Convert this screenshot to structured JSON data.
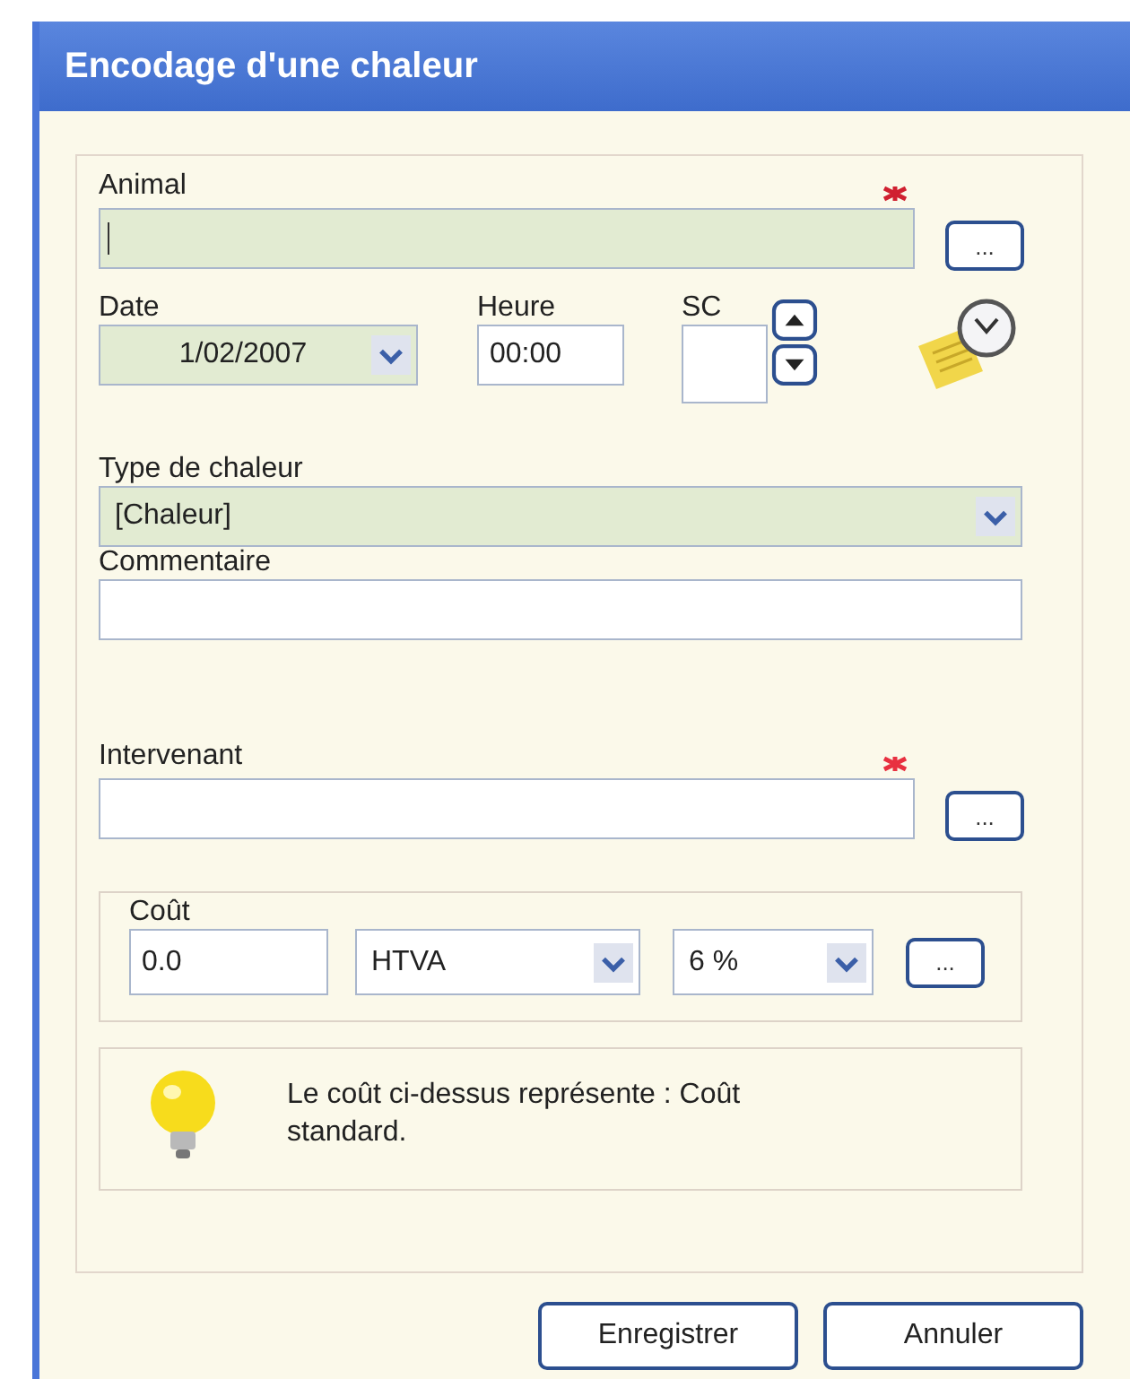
{
  "window": {
    "title": "Encodage d'une chaleur"
  },
  "animal": {
    "label": "Animal",
    "required": true,
    "highlighted": true,
    "focused": true,
    "browse_button": "..."
  },
  "date": {
    "label": "Date",
    "value": "1/02/2007",
    "highlighted": true
  },
  "heure": {
    "label": "Heure",
    "value": "00:00"
  },
  "sc": {
    "label": "SC"
  },
  "type": {
    "label": "Type de chaleur",
    "value": "[Chaleur]",
    "highlighted": true
  },
  "commentaire": {
    "label": "Commentaire"
  },
  "intervenant": {
    "label": "Intervenant",
    "required": true,
    "highlighted": false,
    "browse_button": "..."
  },
  "cout": {
    "label": "Coût",
    "amount": "0.0",
    "tax_mode": "HTVA",
    "rate": "6 %",
    "browse_button": "..."
  },
  "info": {
    "text": "Le coût ci-dessus représente : Coût standard."
  },
  "buttons": [
    "Enregistrer",
    "Annuler"
  ]
}
